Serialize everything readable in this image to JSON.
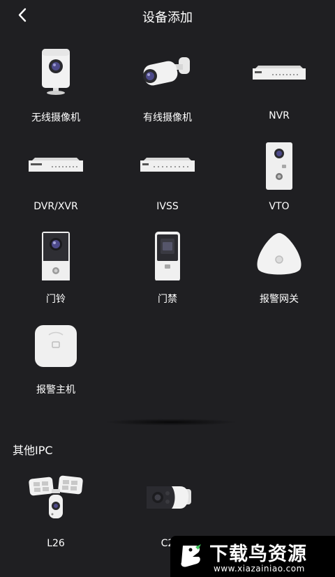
{
  "header": {
    "title": "设备添加",
    "back_icon": "chevron-left-icon"
  },
  "devices": [
    {
      "label": "无线摄像机",
      "icon": "wireless-camera-icon"
    },
    {
      "label": "有线摄像机",
      "icon": "wired-bullet-camera-icon"
    },
    {
      "label": "NVR",
      "icon": "nvr-recorder-icon"
    },
    {
      "label": "DVR/XVR",
      "icon": "dvr-recorder-icon"
    },
    {
      "label": "IVSS",
      "icon": "ivss-server-icon"
    },
    {
      "label": "VTO",
      "icon": "vto-doorstation-icon"
    },
    {
      "label": "门铃",
      "icon": "doorbell-icon"
    },
    {
      "label": "门禁",
      "icon": "access-control-icon"
    },
    {
      "label": "报警网关",
      "icon": "alarm-gateway-icon"
    },
    {
      "label": "报警主机",
      "icon": "alarm-hub-icon"
    }
  ],
  "other_section": {
    "title": "其他IPC",
    "items": [
      {
        "label": "L26",
        "icon": "floodlight-camera-icon"
      },
      {
        "label": "C2",
        "icon": "c2-camera-icon"
      }
    ]
  },
  "watermark": {
    "text": "下载鸟资源",
    "url": "www.xiazainiao.com"
  },
  "colors": {
    "background": "#1f1f22",
    "text": "#ffffff"
  }
}
